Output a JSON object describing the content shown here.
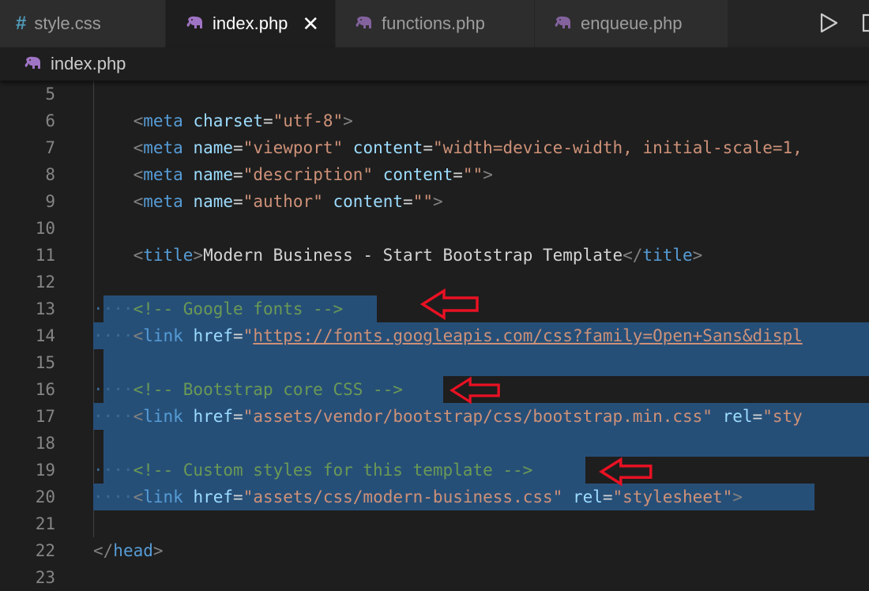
{
  "tabs": [
    {
      "label": "style.css",
      "icon": "css-hash-icon",
      "active": false
    },
    {
      "label": "index.php",
      "icon": "php-elephant-icon",
      "active": true,
      "close": "✕"
    },
    {
      "label": "functions.php",
      "icon": "php-elephant-icon",
      "active": false
    },
    {
      "label": "enqueue.php",
      "icon": "php-elephant-icon",
      "active": false
    }
  ],
  "tab_icons": {
    "css_hash": "#"
  },
  "actions": {
    "run": "run-icon",
    "split": "split-editor-icon"
  },
  "breadcrumb": {
    "file": "index.php",
    "icon": "php-elephant-icon"
  },
  "colors": {
    "accent_selection": "#264f78",
    "annotation_arrow": "#e81123",
    "php_icon": "#a074c4"
  },
  "editor": {
    "line_numbers": [
      "5",
      "6",
      "7",
      "8",
      "9",
      "10",
      "11",
      "12",
      "13",
      "14",
      "15",
      "16",
      "17",
      "18",
      "19",
      "20",
      "21",
      "22",
      "23"
    ],
    "lines": {
      "l6": {
        "open": "<",
        "tag": "meta",
        "a1": "charset",
        "eq": "=",
        "v1": "\"utf-8\"",
        "close": ">"
      },
      "l7": {
        "open": "<",
        "tag": "meta",
        "a1": "name",
        "eq": "=",
        "v1": "\"viewport\"",
        "a2": "content",
        "eq2": "=",
        "v2": "\"width=device-width, initial-scale=1,"
      },
      "l8": {
        "open": "<",
        "tag": "meta",
        "a1": "name",
        "eq": "=",
        "v1": "\"description\"",
        "a2": "content",
        "eq2": "=",
        "v2": "\"\"",
        "close": ">"
      },
      "l9": {
        "open": "<",
        "tag": "meta",
        "a1": "name",
        "eq": "=",
        "v1": "\"author\"",
        "a2": "content",
        "eq2": "=",
        "v2": "\"\"",
        "close": ">"
      },
      "l11": {
        "open": "<",
        "tag": "title",
        "close": ">",
        "text": "Modern Business - Start Bootstrap Template",
        "end_open": "</",
        "end_tag": "title",
        "end_close": ">"
      },
      "l13": {
        "comment": "<!-- Google fonts -->"
      },
      "l14": {
        "open": "<",
        "tag": "link",
        "a1": "href",
        "eq": "=",
        "q": "\"",
        "url": "https://fonts.googleapis.com/css?family=Open+Sans&displ"
      },
      "l16": {
        "comment": "<!-- Bootstrap core CSS -->"
      },
      "l17": {
        "open": "<",
        "tag": "link",
        "a1": "href",
        "eq": "=",
        "v1": "\"assets/vendor/bootstrap/css/bootstrap.min.css\"",
        "a2": "rel",
        "eq2": "=",
        "v2": "\"sty"
      },
      "l19": {
        "comment": "<!-- Custom styles for this template -->"
      },
      "l20": {
        "open": "<",
        "tag": "link",
        "a1": "href",
        "eq": "=",
        "v1": "\"assets/css/modern-business.css\"",
        "a2": "rel",
        "eq2": "=",
        "v2": "\"stylesheet\"",
        "close": ">"
      },
      "l22": {
        "open": "</",
        "tag": "head",
        "close": ">"
      }
    }
  }
}
